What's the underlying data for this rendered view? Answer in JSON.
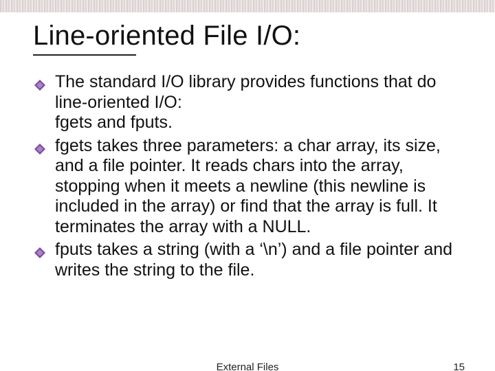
{
  "title": "Line-oriented File I/O:",
  "bullets": [
    "The standard I/O library provides functions that do line-oriented I/O:\nfgets and fputs.",
    "fgets takes three parameters: a char array, its size, and a file pointer. It reads chars into the array, stopping when it meets a newline (this newline is included in the array) or find that the array is full. It terminates the array with a NULL.",
    "fputs takes a string (with a ‘\\n’) and a file pointer and writes the string to the file."
  ],
  "footer": {
    "center": "External Files",
    "page": "15"
  },
  "colors": {
    "bullet_fill": "#7a4aa0",
    "bullet_accent": "#c9a8e8"
  }
}
